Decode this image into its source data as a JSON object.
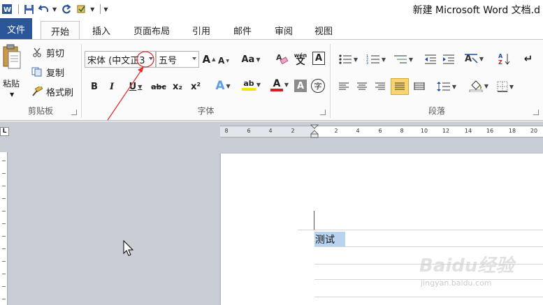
{
  "window": {
    "title": "新建 Microsoft Word 文档.d"
  },
  "tabs": [
    {
      "label": "文件"
    },
    {
      "label": "开始"
    },
    {
      "label": "插入"
    },
    {
      "label": "页面布局"
    },
    {
      "label": "引用"
    },
    {
      "label": "邮件"
    },
    {
      "label": "审阅"
    },
    {
      "label": "视图"
    }
  ],
  "clipboard": {
    "paste_label": "粘贴",
    "cut_label": "剪切",
    "copy_label": "复制",
    "format_painter_label": "格式刷",
    "group_label": "剪贴板"
  },
  "font": {
    "font_name_value": "宋体 (中文正3",
    "font_size_value": "五号",
    "grow_label": "A",
    "shrink_label": "A",
    "change_case_label": "Aa",
    "clear_format_label": "A",
    "phonetic_label": "wén",
    "char_border_label": "A",
    "bold_label": "B",
    "italic_label": "I",
    "underline_label": "U",
    "strike_label": "abc",
    "subscript_label": "x₂",
    "superscript_label": "x²",
    "text_effect_label": "A",
    "highlight_label": "ab",
    "font_color_label": "A",
    "char_shading_label": "A",
    "enclose_label": "字",
    "group_label": "字体"
  },
  "paragraph": {
    "group_label": "段落"
  },
  "ruler": {
    "ticks": [
      "8",
      "6",
      "4",
      "2",
      "2",
      "4",
      "6",
      "8",
      "10",
      "12",
      "14",
      "16",
      "18",
      "20"
    ]
  },
  "document": {
    "selected_text": "测试"
  },
  "watermark": {
    "brand": "Baidu经验",
    "url": "jingyan.baidu.com"
  },
  "colors": {
    "file_tab": "#2b579a",
    "highlight": "#f2e600",
    "font_color": "#d21f1f",
    "annotation": "#e03030",
    "selection": "#b8d3ef"
  }
}
